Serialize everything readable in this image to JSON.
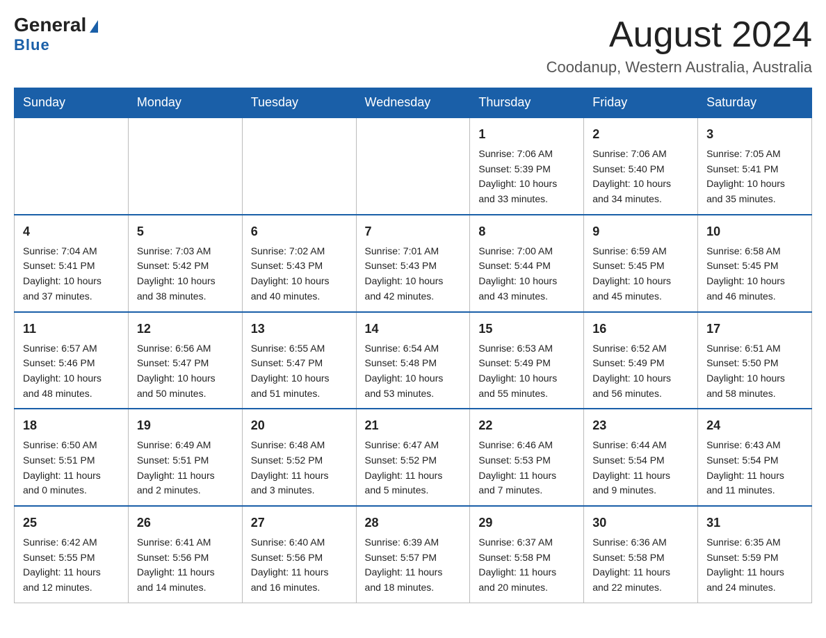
{
  "header": {
    "logo_general": "General",
    "logo_blue": "Blue",
    "month_title": "August 2024",
    "location": "Coodanup, Western Australia, Australia"
  },
  "days_of_week": [
    "Sunday",
    "Monday",
    "Tuesday",
    "Wednesday",
    "Thursday",
    "Friday",
    "Saturday"
  ],
  "weeks": [
    [
      {
        "num": "",
        "sunrise": "",
        "sunset": "",
        "daylight": ""
      },
      {
        "num": "",
        "sunrise": "",
        "sunset": "",
        "daylight": ""
      },
      {
        "num": "",
        "sunrise": "",
        "sunset": "",
        "daylight": ""
      },
      {
        "num": "",
        "sunrise": "",
        "sunset": "",
        "daylight": ""
      },
      {
        "num": "1",
        "sunrise": "Sunrise: 7:06 AM",
        "sunset": "Sunset: 5:39 PM",
        "daylight": "Daylight: 10 hours and 33 minutes."
      },
      {
        "num": "2",
        "sunrise": "Sunrise: 7:06 AM",
        "sunset": "Sunset: 5:40 PM",
        "daylight": "Daylight: 10 hours and 34 minutes."
      },
      {
        "num": "3",
        "sunrise": "Sunrise: 7:05 AM",
        "sunset": "Sunset: 5:41 PM",
        "daylight": "Daylight: 10 hours and 35 minutes."
      }
    ],
    [
      {
        "num": "4",
        "sunrise": "Sunrise: 7:04 AM",
        "sunset": "Sunset: 5:41 PM",
        "daylight": "Daylight: 10 hours and 37 minutes."
      },
      {
        "num": "5",
        "sunrise": "Sunrise: 7:03 AM",
        "sunset": "Sunset: 5:42 PM",
        "daylight": "Daylight: 10 hours and 38 minutes."
      },
      {
        "num": "6",
        "sunrise": "Sunrise: 7:02 AM",
        "sunset": "Sunset: 5:43 PM",
        "daylight": "Daylight: 10 hours and 40 minutes."
      },
      {
        "num": "7",
        "sunrise": "Sunrise: 7:01 AM",
        "sunset": "Sunset: 5:43 PM",
        "daylight": "Daylight: 10 hours and 42 minutes."
      },
      {
        "num": "8",
        "sunrise": "Sunrise: 7:00 AM",
        "sunset": "Sunset: 5:44 PM",
        "daylight": "Daylight: 10 hours and 43 minutes."
      },
      {
        "num": "9",
        "sunrise": "Sunrise: 6:59 AM",
        "sunset": "Sunset: 5:45 PM",
        "daylight": "Daylight: 10 hours and 45 minutes."
      },
      {
        "num": "10",
        "sunrise": "Sunrise: 6:58 AM",
        "sunset": "Sunset: 5:45 PM",
        "daylight": "Daylight: 10 hours and 46 minutes."
      }
    ],
    [
      {
        "num": "11",
        "sunrise": "Sunrise: 6:57 AM",
        "sunset": "Sunset: 5:46 PM",
        "daylight": "Daylight: 10 hours and 48 minutes."
      },
      {
        "num": "12",
        "sunrise": "Sunrise: 6:56 AM",
        "sunset": "Sunset: 5:47 PM",
        "daylight": "Daylight: 10 hours and 50 minutes."
      },
      {
        "num": "13",
        "sunrise": "Sunrise: 6:55 AM",
        "sunset": "Sunset: 5:47 PM",
        "daylight": "Daylight: 10 hours and 51 minutes."
      },
      {
        "num": "14",
        "sunrise": "Sunrise: 6:54 AM",
        "sunset": "Sunset: 5:48 PM",
        "daylight": "Daylight: 10 hours and 53 minutes."
      },
      {
        "num": "15",
        "sunrise": "Sunrise: 6:53 AM",
        "sunset": "Sunset: 5:49 PM",
        "daylight": "Daylight: 10 hours and 55 minutes."
      },
      {
        "num": "16",
        "sunrise": "Sunrise: 6:52 AM",
        "sunset": "Sunset: 5:49 PM",
        "daylight": "Daylight: 10 hours and 56 minutes."
      },
      {
        "num": "17",
        "sunrise": "Sunrise: 6:51 AM",
        "sunset": "Sunset: 5:50 PM",
        "daylight": "Daylight: 10 hours and 58 minutes."
      }
    ],
    [
      {
        "num": "18",
        "sunrise": "Sunrise: 6:50 AM",
        "sunset": "Sunset: 5:51 PM",
        "daylight": "Daylight: 11 hours and 0 minutes."
      },
      {
        "num": "19",
        "sunrise": "Sunrise: 6:49 AM",
        "sunset": "Sunset: 5:51 PM",
        "daylight": "Daylight: 11 hours and 2 minutes."
      },
      {
        "num": "20",
        "sunrise": "Sunrise: 6:48 AM",
        "sunset": "Sunset: 5:52 PM",
        "daylight": "Daylight: 11 hours and 3 minutes."
      },
      {
        "num": "21",
        "sunrise": "Sunrise: 6:47 AM",
        "sunset": "Sunset: 5:52 PM",
        "daylight": "Daylight: 11 hours and 5 minutes."
      },
      {
        "num": "22",
        "sunrise": "Sunrise: 6:46 AM",
        "sunset": "Sunset: 5:53 PM",
        "daylight": "Daylight: 11 hours and 7 minutes."
      },
      {
        "num": "23",
        "sunrise": "Sunrise: 6:44 AM",
        "sunset": "Sunset: 5:54 PM",
        "daylight": "Daylight: 11 hours and 9 minutes."
      },
      {
        "num": "24",
        "sunrise": "Sunrise: 6:43 AM",
        "sunset": "Sunset: 5:54 PM",
        "daylight": "Daylight: 11 hours and 11 minutes."
      }
    ],
    [
      {
        "num": "25",
        "sunrise": "Sunrise: 6:42 AM",
        "sunset": "Sunset: 5:55 PM",
        "daylight": "Daylight: 11 hours and 12 minutes."
      },
      {
        "num": "26",
        "sunrise": "Sunrise: 6:41 AM",
        "sunset": "Sunset: 5:56 PM",
        "daylight": "Daylight: 11 hours and 14 minutes."
      },
      {
        "num": "27",
        "sunrise": "Sunrise: 6:40 AM",
        "sunset": "Sunset: 5:56 PM",
        "daylight": "Daylight: 11 hours and 16 minutes."
      },
      {
        "num": "28",
        "sunrise": "Sunrise: 6:39 AM",
        "sunset": "Sunset: 5:57 PM",
        "daylight": "Daylight: 11 hours and 18 minutes."
      },
      {
        "num": "29",
        "sunrise": "Sunrise: 6:37 AM",
        "sunset": "Sunset: 5:58 PM",
        "daylight": "Daylight: 11 hours and 20 minutes."
      },
      {
        "num": "30",
        "sunrise": "Sunrise: 6:36 AM",
        "sunset": "Sunset: 5:58 PM",
        "daylight": "Daylight: 11 hours and 22 minutes."
      },
      {
        "num": "31",
        "sunrise": "Sunrise: 6:35 AM",
        "sunset": "Sunset: 5:59 PM",
        "daylight": "Daylight: 11 hours and 24 minutes."
      }
    ]
  ]
}
